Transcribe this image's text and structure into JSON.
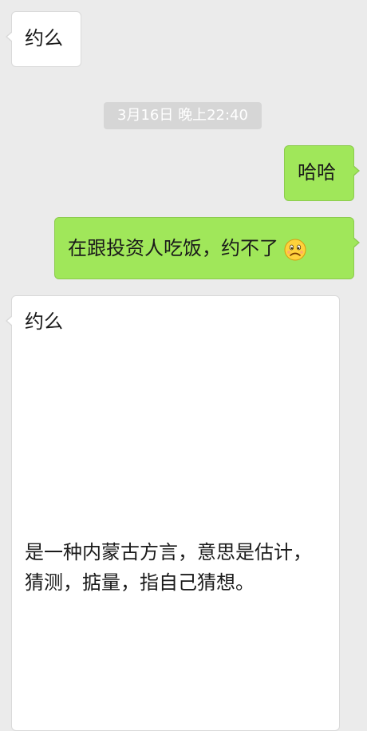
{
  "messages": [
    {
      "id": "m1",
      "direction": "incoming",
      "text": "约么"
    },
    {
      "id": "m2",
      "direction": "outgoing",
      "text": "哈哈"
    },
    {
      "id": "m3",
      "direction": "outgoing",
      "text": "在跟投资人吃饭，约不了",
      "emoji": "frowning-face"
    },
    {
      "id": "m4",
      "direction": "incoming",
      "title": "约么",
      "body": "是一种内蒙古方言，意思是估计，猜测，掂量，指自己猜想。"
    }
  ],
  "timestamp": "3月16日 晚上22:40",
  "colors": {
    "background": "#ebebeb",
    "incoming_bubble": "#ffffff",
    "outgoing_bubble": "#a0e75a",
    "timestamp_pill": "#d6d6d6"
  }
}
